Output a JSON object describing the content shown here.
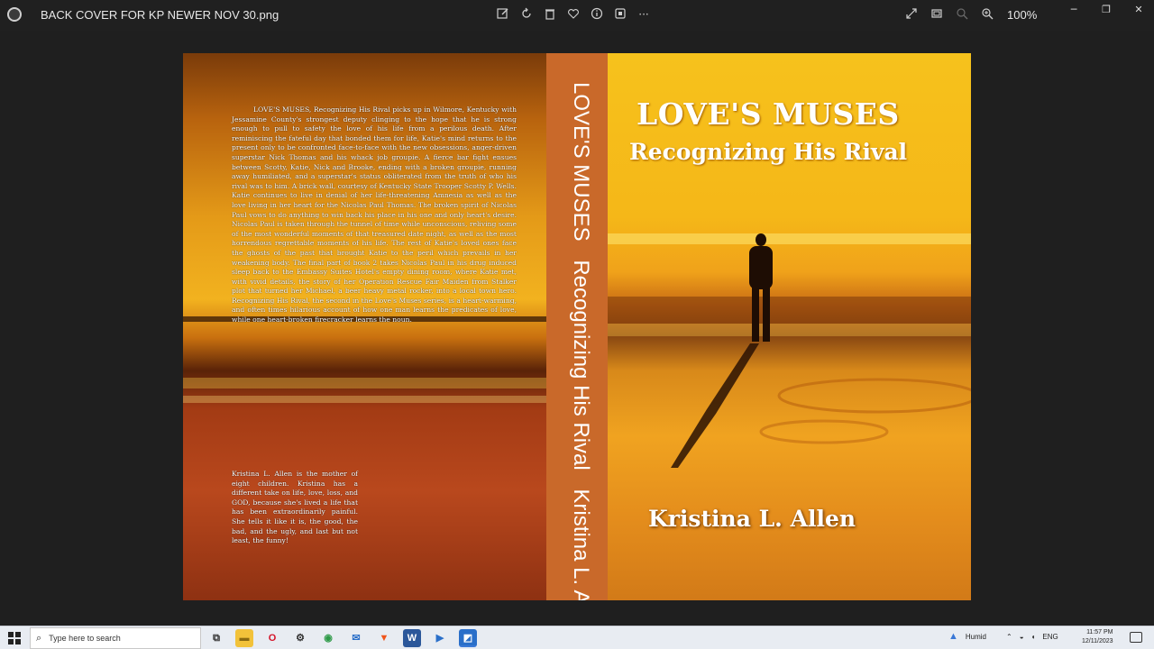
{
  "window": {
    "file_name": "BACK COVER FOR KP NEWER NOV 30.png",
    "zoom": "100%",
    "toolbar_icons": [
      "edit-icon",
      "rotate-icon",
      "delete-icon",
      "favorite-icon",
      "info-icon",
      "crop-icon",
      "more-icon"
    ],
    "right_icons": [
      "fullscreen-icon",
      "fit-icon",
      "zoom-out-icon",
      "zoom-in-icon"
    ]
  },
  "cover": {
    "back_blurb": "LOVE'S MUSES, Recognizing His Rival picks up in Wilmore, Kentucky with Jessamine County's strongest deputy clinging to the hope that he is strong enough to pull to safety the love of his life from a perilous death. After reminiscing the fateful day that bonded them for life, Katie's mind returns to the present only to be confronted face-to-face with the new obsessions, anger-driven superstar Nick Thomas and his whack job groupie. A fierce bar fight ensues between Scotty, Katie, Nick and Brooke, ending with a broken groupie, running away humiliated, and a superstar's status obliterated from the truth of who his rival was to him. A brick wall, courtesy of Kentucky State Trooper Scotty P. Wells. Katie continues to live in denial of her life-threatening Amnesia as well as the love living in her heart for the Nicolas Paul Thomas. The broken spirit of Nicolas Paul vows to do anything to win back his place in his one and only heart's desire. Nicolas Paul is taken through the tunnel of time while unconscious, reliving some of the most wonderful moments of that treasured date night, as well as the most horrendous regrettable moments of his life. The rest of Katie's loved ones face the ghosts of the past that brought Katie to the peril which prevails in her weakening body. The final part of book 2 takes Nicolas Paul in his drug induced sleep back to the Embassy Suites Hotel's empty dining room, where Katie met, with vivid details, the story of her Operation Rescue Fair Maiden from Stalker plot that turned her Michael, a beer heavy metal rocker, into a local town hero. Recognizing His Rival, the second in the Love's Muses series, is a heart-warming, and often times hilarious account of how one man learns the predicates of love, while one heart-broken firecracker learns the noun.",
    "author_bio": "Kristina L. Allen is the mother of eight children. Kristina has a different take on life, love, loss, and GOD, because she's lived a life that has been extraordinarily painful. She tells it like it is, the good, the bad, and the ugly, and last but not least, the funny!",
    "spine": {
      "title": "LOVE'S MUSES",
      "subtitle": "Recognizing His Rival",
      "author": "Kristina L. Allen"
    },
    "front": {
      "title": "LOVE'S MUSES",
      "subtitle": "Recognizing His Rival",
      "author": "Kristina L. Allen"
    }
  },
  "taskbar": {
    "search_placeholder": "Type here to search",
    "apps": [
      {
        "name": "task-view-icon",
        "glyph": "⧉",
        "bg": "#e8ecf2",
        "fg": "#333333"
      },
      {
        "name": "file-explorer-icon",
        "glyph": "▬",
        "bg": "#f2c23a",
        "fg": "#8a6a10"
      },
      {
        "name": "opera-icon",
        "glyph": "O",
        "bg": "#e8ecf2",
        "fg": "#d4142a"
      },
      {
        "name": "settings-icon",
        "glyph": "⚙",
        "bg": "#e8ecf2",
        "fg": "#333333"
      },
      {
        "name": "chrome-icon",
        "glyph": "◉",
        "bg": "#e8ecf2",
        "fg": "#2e9a48"
      },
      {
        "name": "mail-icon",
        "glyph": "✉",
        "bg": "#e8ecf2",
        "fg": "#2a6fc9"
      },
      {
        "name": "brave-icon",
        "glyph": "▼",
        "bg": "#e8ecf2",
        "fg": "#f0541a"
      },
      {
        "name": "word-icon",
        "glyph": "W",
        "bg": "#2b579a",
        "fg": "#ffffff"
      },
      {
        "name": "video-editor-icon",
        "glyph": "▶",
        "bg": "#e8ecf2",
        "fg": "#2a6fc9"
      },
      {
        "name": "photos-icon",
        "glyph": "◩",
        "bg": "#2a6fc9",
        "fg": "#ffffff"
      }
    ],
    "weather": "Humid",
    "language": "ENG",
    "time": "11:57 PM",
    "date": "12/11/2023"
  }
}
